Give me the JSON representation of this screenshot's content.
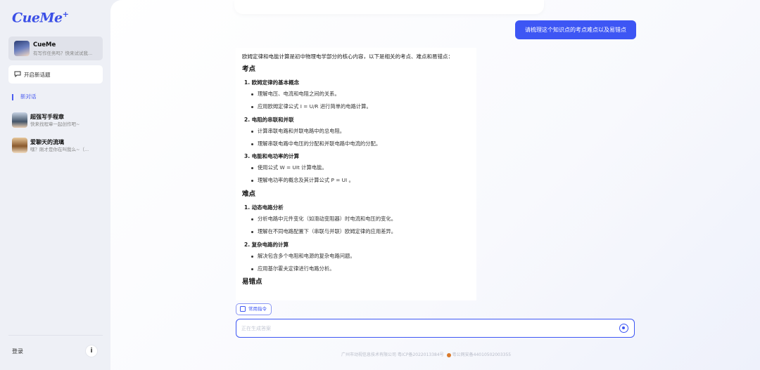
{
  "sidebar": {
    "logo": "CueMe",
    "logo_mark": "+",
    "agent": {
      "name": "CueMe",
      "desc": "有写作任务吗？快来试试我..."
    },
    "new_topic": "开启新话题",
    "current_conversation": "新对话",
    "chats": [
      {
        "title": "超强写手程章",
        "desc": "快来找程章一起创作吧~"
      },
      {
        "title": "爱聊天的流璃",
        "desc": "嘿？刚才是你在叫我么~（..."
      }
    ],
    "login": "登录",
    "info_icon": "i"
  },
  "conversation": {
    "user_message": "请梳理这个知识点的考点难点以及易错点",
    "answer": {
      "intro": "欧姆定律和电能计算是初中物理电学部分的核心内容，以下是相关的考点、难点和易错点：",
      "sections": [
        {
          "heading": "考点",
          "items": [
            {
              "title": "1. 欧姆定律的基本概念",
              "bullets": [
                "理解电压、电流和电阻之间的关系。",
                "应用欧姆定律公式 I = U/R 进行简单的电路计算。"
              ]
            },
            {
              "title": "2. 电阻的串联和并联",
              "bullets": [
                "计算串联电路和并联电路中的总电阻。",
                "理解串联电路中电压的分配和并联电路中电流的分配。"
              ]
            },
            {
              "title": "3. 电能和电功率的计算",
              "bullets": [
                "使用公式 W = UIt 计算电能。",
                "理解电功率的概念及其计算公式 P = UI 。"
              ]
            }
          ]
        },
        {
          "heading": "难点",
          "items": [
            {
              "title": "1. 动态电路分析",
              "bullets": [
                "分析电路中元件变化（如滑动变阻器）时电流和电压的变化。",
                "理解在不同电路配置下（串联与并联）欧姆定律的应用差异。"
              ]
            },
            {
              "title": "2. 复杂电路的计算",
              "bullets": [
                "解决包含多个电阻和电源的复杂电路问题。",
                "应用基尔霍夫定律进行电路分析。"
              ]
            }
          ]
        },
        {
          "heading": "易错点",
          "items": []
        }
      ]
    }
  },
  "composer": {
    "command_button": "常用指令",
    "input_value": "",
    "input_placeholder": "正在生成答案"
  },
  "footer": {
    "icp": "广州市动视信息技术有限公司 粤ICP备2022013384号",
    "police": "粤公网安备44010502003355"
  }
}
